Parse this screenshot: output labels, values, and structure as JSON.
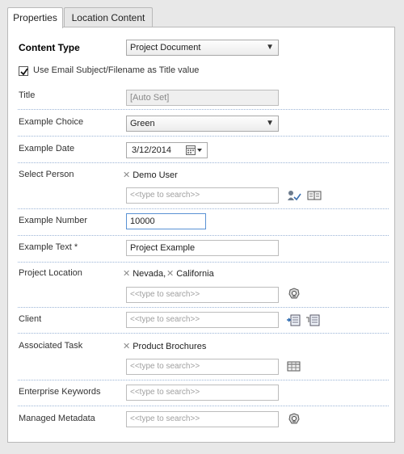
{
  "tabs": [
    {
      "label": "Properties"
    },
    {
      "label": "Location Content"
    }
  ],
  "form": {
    "content_type": {
      "label": "Content Type",
      "value": "Project Document"
    },
    "use_email_subject": {
      "label": "Use Email Subject/Filename as Title value",
      "checked": true
    },
    "title": {
      "label": "Title",
      "value": "[Auto Set]"
    },
    "example_choice": {
      "label": "Example Choice",
      "value": "Green"
    },
    "example_date": {
      "label": "Example Date",
      "value": "3/12/2014"
    },
    "select_person": {
      "label": "Select Person",
      "selected": [
        "Demo User"
      ],
      "placeholder": "<<type to search>>"
    },
    "example_number": {
      "label": "Example Number",
      "value": "10000"
    },
    "example_text": {
      "label": "Example Text *",
      "value": "Project Example"
    },
    "project_location": {
      "label": "Project Location",
      "selected": [
        "Nevada,",
        "California"
      ],
      "placeholder": "<<type to search>>"
    },
    "client": {
      "label": "Client",
      "placeholder": "<<type to search>>"
    },
    "associated_task": {
      "label": "Associated Task",
      "selected": [
        "Product Brochures"
      ],
      "placeholder": "<<type to search>>"
    },
    "enterprise_keywords": {
      "label": "Enterprise Keywords",
      "placeholder": "<<type to search>>"
    },
    "managed_metadata": {
      "label": "Managed Metadata",
      "placeholder": "<<type to search>>"
    }
  },
  "icons": {
    "check_names": "check-names-icon",
    "browse_book": "address-book-icon",
    "taxonomy": "taxonomy-picker-icon",
    "lookup_add": "lookup-add-icon",
    "lookup_browse": "lookup-browse-icon",
    "grid_picker": "grid-picker-icon",
    "calendar": "calendar-icon",
    "remove": "remove-x-icon"
  },
  "colors": {
    "focus_border": "#5a92d4",
    "separator": "#9bb4d6"
  }
}
